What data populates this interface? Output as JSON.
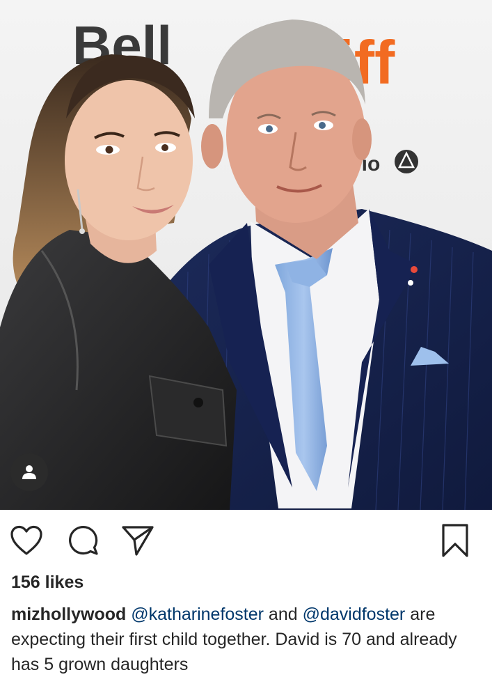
{
  "post": {
    "photo": {
      "description_icon": "photo",
      "backdrop_logos": {
        "bell": "Bell",
        "tiff": "tiff",
        "ontario": "rio"
      }
    },
    "tag_button": {
      "icon": "person-icon"
    },
    "actions": {
      "like_icon": "heart-icon",
      "comment_icon": "comment-icon",
      "share_icon": "paper-plane-icon",
      "save_icon": "bookmark-icon"
    },
    "likes_text": "156 likes",
    "caption": {
      "username": "mizhollywood",
      "mention_1": "@katharinefoster",
      "text_1": " and ",
      "mention_2": "@davidfoster",
      "text_2": " are expecting their first child together. David is 70 and already has 5 grown daughters"
    }
  }
}
